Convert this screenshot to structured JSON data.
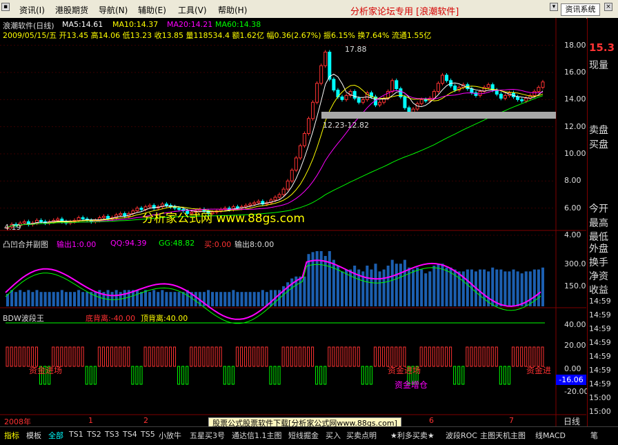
{
  "menu": {
    "items": [
      "资讯(I)",
      "港股期货",
      "导航(N)",
      "辅助(E)",
      "工具(V)",
      "帮助(H)"
    ],
    "brand": "分析家论坛专用 [浪潮软件]",
    "system_button": "资讯系统"
  },
  "main_chart": {
    "title": "浪潮软件(日线)",
    "ma5": "MA5:14.61",
    "ma10": "MA10:14.37",
    "ma20": "MA20:14.21",
    "ma60": "MA60:14.38",
    "info_line": "2009/05/15/五 开13.45 高14.06 低13.23 收13.85 量118534.4 额1.62亿 幅0.36(2.67%) 振6.15% 换7.64% 流通1.55亿",
    "annotation_high": "17.88",
    "annotation_band": "12.23-12.82",
    "annotation_low": "4.19",
    "watermark": "分析家公式网 www.88gs.com",
    "y_ticks": [
      "18.00",
      "16.00",
      "14.00",
      "12.00",
      "10.00",
      "8.00",
      "6.00",
      "4.00"
    ]
  },
  "sub1": {
    "title": "凸凹合并副图",
    "out": "输出1:0.00",
    "qq": "QQ:94.39",
    "gg": "GG:48.82",
    "buy": "买:0.00",
    "out8": "输出8:0.00",
    "y_ticks": [
      "300.0",
      "150.0"
    ]
  },
  "sub2": {
    "title": "BDW波段王",
    "bottom": "底背离:-40.00",
    "top": "顶背离:40.00",
    "label_in": "资金进场",
    "label_in2": "资金进场",
    "label_increase": "资金增仓",
    "label_in3": "资金进",
    "y_ticks": [
      "40.00",
      "20.00",
      "0.00",
      "-20.00"
    ],
    "current_value": "-16.06"
  },
  "axis": {
    "year": "2008年",
    "months": [
      "1",
      "2",
      "6",
      "7"
    ]
  },
  "right_panel": {
    "price": "15.3",
    "labels": [
      "现量",
      "卖盘",
      "买盘",
      "今开",
      "最高",
      "最低",
      "外盘",
      "换手",
      "净资",
      "收益"
    ],
    "times": [
      "14:59",
      "14:59",
      "14:59",
      "14:59",
      "14:59",
      "14:59",
      "14:59",
      "15:00",
      "15:00"
    ]
  },
  "bottom": {
    "tabs": [
      "指标",
      "模板",
      "全部",
      "TS1",
      "TS2",
      "TS3",
      "TS4",
      "TS5",
      "小放牛",
      "五星买3号",
      "通达信1.1主图",
      "短线掘金",
      "买入",
      "买卖点明",
      "★利多买卖★",
      "波段ROC",
      "主图天机主图",
      "线MACD"
    ],
    "ad": "股票公式股票软件下载[分析家公式网www.88gs.com]",
    "period": "日线",
    "right_label": "笔"
  },
  "colors": {
    "up": "#ff3232",
    "down": "#00ffff",
    "ma5": "#ffffff",
    "ma10": "#ffff00",
    "ma20": "#ff00ff",
    "ma60": "#00ff00"
  },
  "chart_data": {
    "type": "candlestick",
    "ylim": [
      4,
      19
    ],
    "closes": [
      4.6,
      4.8,
      4.7,
      4.9,
      5.0,
      4.8,
      4.9,
      5.1,
      5.0,
      4.9,
      5.0,
      5.1,
      5.2,
      5.0,
      4.9,
      5.0,
      5.1,
      5.3,
      5.2,
      5.1,
      5.0,
      5.1,
      5.3,
      5.4,
      5.2,
      5.3,
      5.5,
      5.6,
      5.4,
      5.6,
      5.8,
      6.0,
      5.9,
      6.1,
      6.2,
      6.0,
      6.1,
      6.3,
      6.2,
      6.1,
      6.0,
      5.9,
      5.8,
      5.6,
      5.7,
      5.8,
      5.9,
      5.8,
      5.6,
      5.7,
      5.8,
      5.9,
      6.0,
      5.9,
      6.1,
      6.0,
      6.1,
      6.2,
      6.3,
      6.4,
      6.5,
      6.3,
      6.4,
      6.6,
      6.8,
      7.0,
      7.4,
      8.0,
      8.8,
      9.7,
      10.6,
      11.5,
      12.6,
      13.8,
      15.2,
      16.5,
      17.5,
      15.5,
      14.7,
      14.2,
      14.0,
      14.3,
      14.6,
      14.1,
      13.8,
      14.0,
      14.5,
      14.2,
      13.6,
      13.8,
      14.1,
      14.6,
      15.4,
      14.8,
      14.2,
      13.4,
      13.0,
      13.3,
      13.7,
      14.0,
      13.9,
      14.1,
      14.6,
      15.2,
      15.8,
      15.4,
      15.0,
      14.7,
      14.9,
      15.1,
      14.8,
      14.5,
      14.3,
      14.6,
      14.9,
      15.1,
      14.7,
      14.4,
      14.1,
      14.3,
      14.5,
      14.2,
      14.0,
      13.9,
      14.1,
      14.3,
      14.6,
      14.9,
      15.3
    ]
  }
}
